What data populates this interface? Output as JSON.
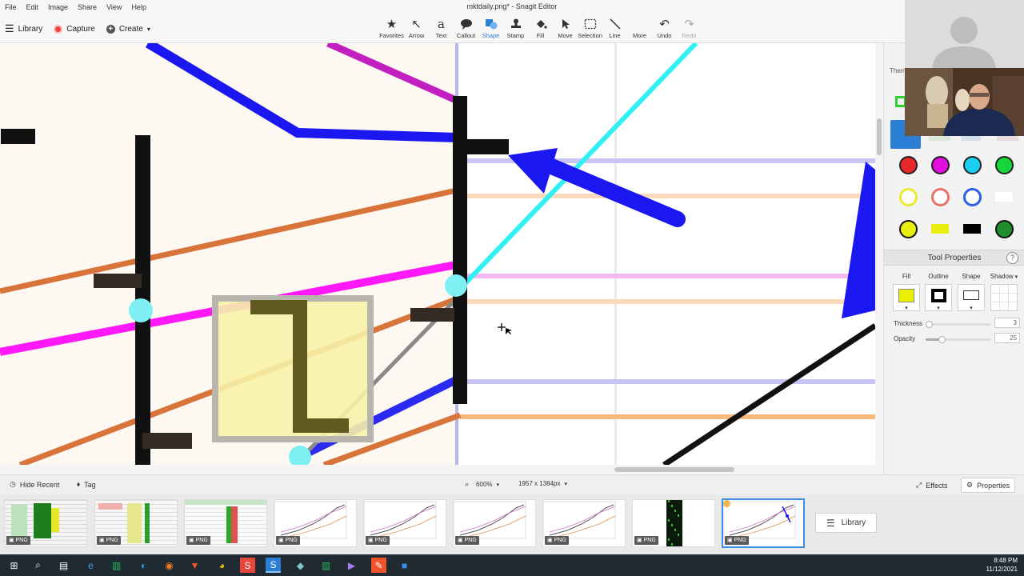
{
  "window": {
    "title": "mktdaily.png* - Snagit Editor"
  },
  "menu": [
    "File",
    "Edit",
    "Image",
    "Share",
    "View",
    "Help"
  ],
  "toolbar_left": {
    "library": "Library",
    "capture": "Capture",
    "create": "Create"
  },
  "tools": [
    {
      "label": "Favorites",
      "icon": "star-icon"
    },
    {
      "label": "Arrow",
      "icon": "arrow-icon"
    },
    {
      "label": "Text",
      "icon": "text-icon"
    },
    {
      "label": "Callout",
      "icon": "callout-icon"
    },
    {
      "label": "Shape",
      "icon": "shape-icon",
      "active": true
    },
    {
      "label": "Stamp",
      "icon": "stamp-icon"
    },
    {
      "label": "Fill",
      "icon": "fill-icon"
    },
    {
      "label": "Move",
      "icon": "move-icon"
    },
    {
      "label": "Selection",
      "icon": "selection-icon"
    },
    {
      "label": "Line",
      "icon": "line-icon"
    },
    {
      "label": "More",
      "icon": "more-icon"
    },
    {
      "label": "Undo",
      "icon": "undo-icon"
    },
    {
      "label": "Redo",
      "icon": "redo-icon",
      "disabled": true
    }
  ],
  "right_panel": {
    "themes_label": "Them",
    "swatches": [
      {
        "kind": "fill",
        "color": "#e8292b"
      },
      {
        "kind": "fill",
        "color": "#e10ee0"
      },
      {
        "kind": "fill",
        "color": "#1ad0ee"
      },
      {
        "kind": "fill",
        "color": "#16d63c"
      },
      {
        "kind": "ring",
        "color": "#eaea2e"
      },
      {
        "kind": "ring",
        "color": "#e8726b"
      },
      {
        "kind": "ring",
        "color": "#2a5ee8"
      },
      {
        "kind": "blank",
        "color": "#ffffff"
      },
      {
        "kind": "fill-ring",
        "color": "#e8ee10"
      },
      {
        "kind": "rect",
        "color": "#e8ee10"
      },
      {
        "kind": "rect",
        "color": "#000000"
      },
      {
        "kind": "fill-ring",
        "color": "#1f8e2b"
      }
    ],
    "tool_properties": {
      "title": "Tool Properties",
      "help": "?",
      "fill_label": "Fill",
      "outline_label": "Outline",
      "shape_label": "Shape",
      "shadow_label": "Shadow",
      "fill_color": "#e8f000",
      "thickness_label": "Thickness",
      "thickness_value": "3",
      "opacity_label": "Opacity",
      "opacity_value": "25"
    }
  },
  "statusbar": {
    "hide_recent": "Hide Recent",
    "tag": "Tag",
    "zoom": "600%",
    "dimensions": "1957 x 1384px",
    "effects": "Effects",
    "properties": "Properties"
  },
  "tray": {
    "thumbnails": [
      {
        "badge": "PNG",
        "kind": "sheet-green"
      },
      {
        "badge": "PNG",
        "kind": "sheet-multi"
      },
      {
        "badge": "PNG",
        "kind": "sheet-light"
      },
      {
        "badge": "PNG",
        "kind": "chart"
      },
      {
        "badge": "PNG",
        "kind": "chart"
      },
      {
        "badge": "PNG",
        "kind": "chart"
      },
      {
        "badge": "PNG",
        "kind": "chart"
      },
      {
        "badge": "PNG",
        "kind": "dark"
      },
      {
        "badge": "PNG",
        "kind": "chart-selected",
        "selected": true
      }
    ],
    "library_button": "Library"
  },
  "taskbar": {
    "time": "8:48 PM",
    "date": "11/12/2021"
  }
}
